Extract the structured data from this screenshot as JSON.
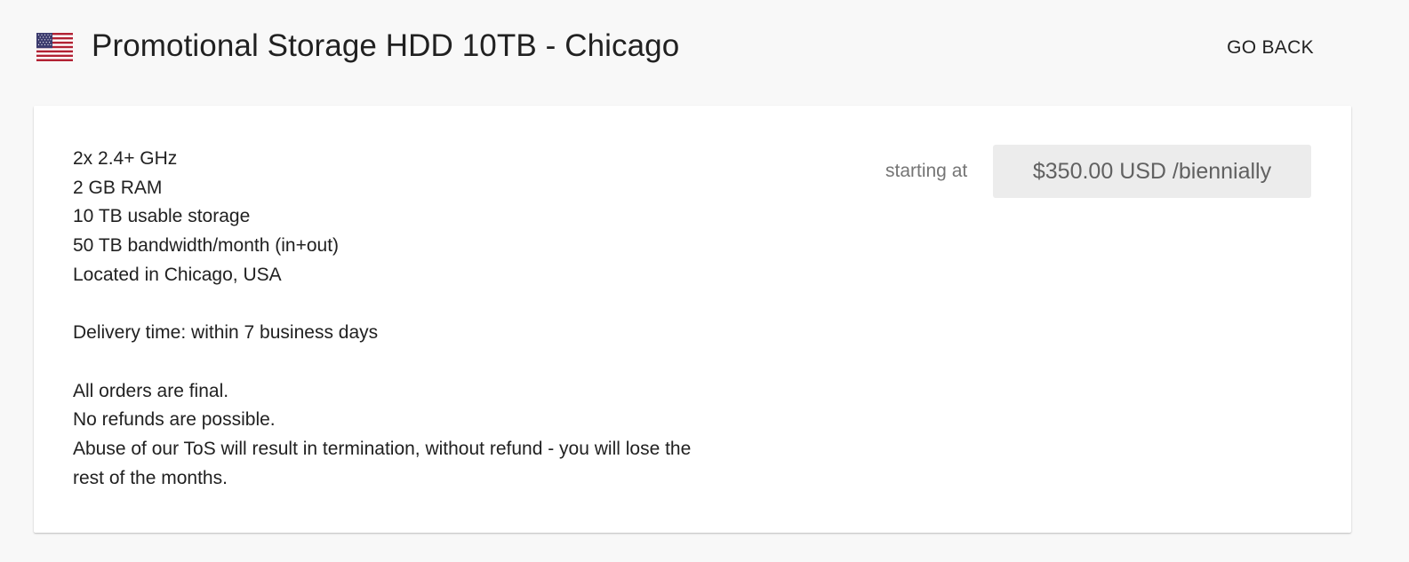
{
  "header": {
    "flag_icon": "us-flag-icon",
    "title": "Promotional Storage HDD 10TB - Chicago",
    "go_back_label": "GO BACK"
  },
  "product": {
    "specs": [
      "2x 2.4+ GHz",
      "2 GB RAM",
      "10 TB usable storage",
      "50 TB bandwidth/month (in+out)",
      "Located in Chicago, USA"
    ],
    "delivery": "Delivery time: within 7 business days",
    "terms": [
      "All orders are final.",
      "No refunds are possible.",
      "Abuse of our ToS will result in termination, without refund - you will lose the rest of the months."
    ],
    "starting_label": "starting at",
    "price": "$350.00 USD /biennially"
  },
  "colors": {
    "page_background": "#f8f8f8",
    "card_background": "#ffffff",
    "price_background": "#ececec",
    "flag_red": "#b22234",
    "flag_blue": "#3c3b6e"
  }
}
